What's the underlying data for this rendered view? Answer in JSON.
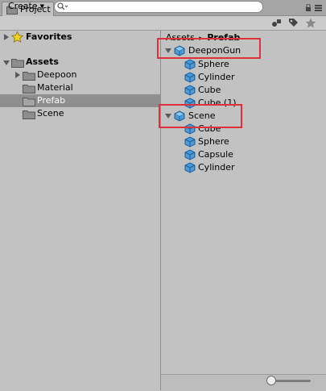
{
  "window": {
    "tab_title": "Project"
  },
  "toolbar": {
    "create_label": "Create",
    "search_value": ""
  },
  "tree": {
    "favorites": "Favorites",
    "assets": "Assets",
    "folders": [
      "Deepoon",
      "Material",
      "Prefab",
      "Scene"
    ],
    "selected": "Prefab"
  },
  "breadcrumb": {
    "root": "Assets",
    "separator": "▸",
    "current": "Prefab"
  },
  "prefabs": [
    {
      "name": "DeeponGun",
      "children": [
        "Sphere",
        "Cylinder",
        "Cube",
        "Cube (1)"
      ]
    },
    {
      "name": "Scene",
      "children": [
        "Cube",
        "Sphere",
        "Capsule",
        "Cylinder"
      ]
    }
  ],
  "colors": {
    "highlight": "#e0303a",
    "cube": "#4a9bd8",
    "selection": "#8f8f8f"
  }
}
